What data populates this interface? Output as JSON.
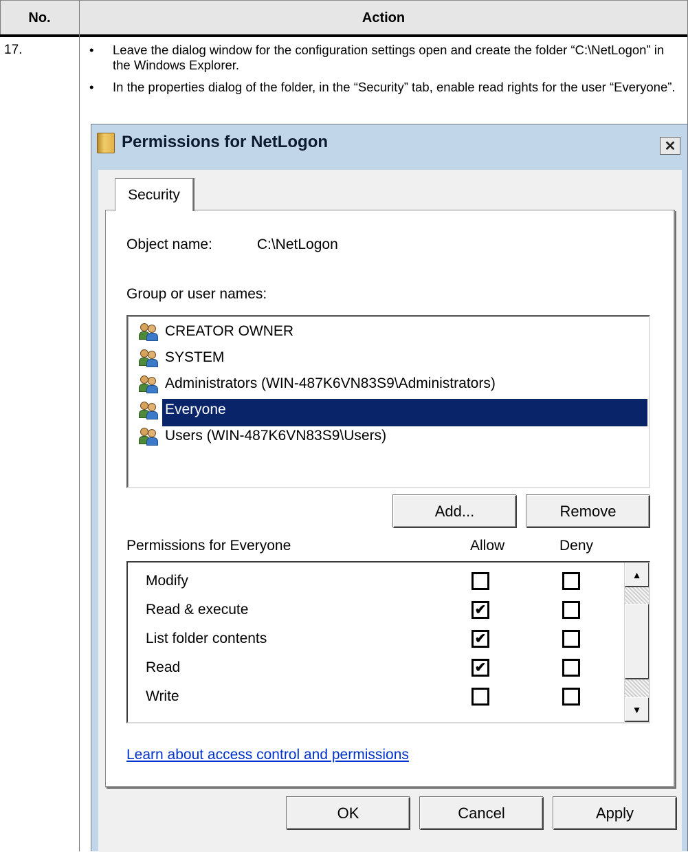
{
  "table": {
    "header_no": "No.",
    "header_action": "Action",
    "step_no": "17.",
    "bullets": [
      "Leave the dialog window for the configuration settings open and create the folder “C:\\NetLogon” in the Windows Explorer.",
      "In the properties dialog of the folder, in the “Security” tab, enable read rights for the user “Everyone”."
    ]
  },
  "dialog": {
    "title": "Permissions for NetLogon",
    "close_glyph": "✕",
    "tab_label": "Security",
    "object_name_label": "Object name:",
    "object_name_value": "C:\\NetLogon",
    "group_label": "Group or user names:",
    "users": [
      "CREATOR OWNER",
      "SYSTEM",
      "Administrators (WIN-487K6VN83S9\\Administrators)",
      "Everyone",
      "Users (WIN-487K6VN83S9\\Users)"
    ],
    "selected_user_index": 3,
    "add_button": "Add...",
    "remove_button": "Remove",
    "permissions_label": "Permissions for Everyone",
    "allow_label": "Allow",
    "deny_label": "Deny",
    "permissions": [
      {
        "name": "Modify",
        "allow": false,
        "deny": false
      },
      {
        "name": "Read & execute",
        "allow": true,
        "deny": false
      },
      {
        "name": "List folder contents",
        "allow": true,
        "deny": false
      },
      {
        "name": "Read",
        "allow": true,
        "deny": false
      },
      {
        "name": "Write",
        "allow": false,
        "deny": false
      }
    ],
    "learn_link": "Learn about access control and permissions",
    "ok_button": "OK",
    "cancel_button": "Cancel",
    "apply_button": "Apply"
  },
  "icons": {
    "folder": "folder-icon",
    "user_group": "user-group-icon",
    "checkmark": "✔",
    "scroll_up": "▲",
    "scroll_down": "▼"
  }
}
